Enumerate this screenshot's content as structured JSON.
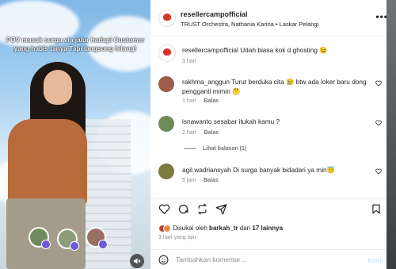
{
  "media": {
    "caption": "POV masuk surga via jalur hadapi Customer yang habis tanya Tapi langsung hilang!",
    "mute_icon": "speaker-muted-icon"
  },
  "header": {
    "username": "resellercampofficial",
    "subtitle": "TRUST Orchestra, Nathania Karina • Laskar Pelangi",
    "more_icon": "more-horizontal-icon"
  },
  "comments": [
    {
      "user": "resellercampofficial",
      "text": "Udah biasa kok d ghosting 😉",
      "time": "3 hari",
      "reply": "",
      "liked": false
    },
    {
      "user": "rakhma_anggun",
      "text": "Turut berduka cita 😢 btw ada loker baru dong pengganti mimin 🤔",
      "time": "1 hari",
      "reply": "Balas"
    },
    {
      "user": "isnawanto",
      "text": "sesabar itukah kamu ?",
      "time": "2 hari",
      "reply": "Balas",
      "replies_label": "Lihat balasan (1)"
    },
    {
      "user": "agil.wadriansyah",
      "text": "Di surga banyak bidadari ya min😇",
      "time": "5 jam",
      "reply": "Balas"
    }
  ],
  "actions": {
    "like_icon": "heart-icon",
    "comment_icon": "comment-icon",
    "share_icon": "repost-icon",
    "send_icon": "send-icon",
    "save_icon": "bookmark-icon"
  },
  "likes": {
    "prefix": "Disukai oleh",
    "first_user": "barkah_tr",
    "joiner": "dan",
    "others": "17 lainnya"
  },
  "posted_time": "3 hari yang lalu",
  "composer": {
    "placeholder": "Tambahkan komentar…",
    "post_label": "Kirim"
  }
}
